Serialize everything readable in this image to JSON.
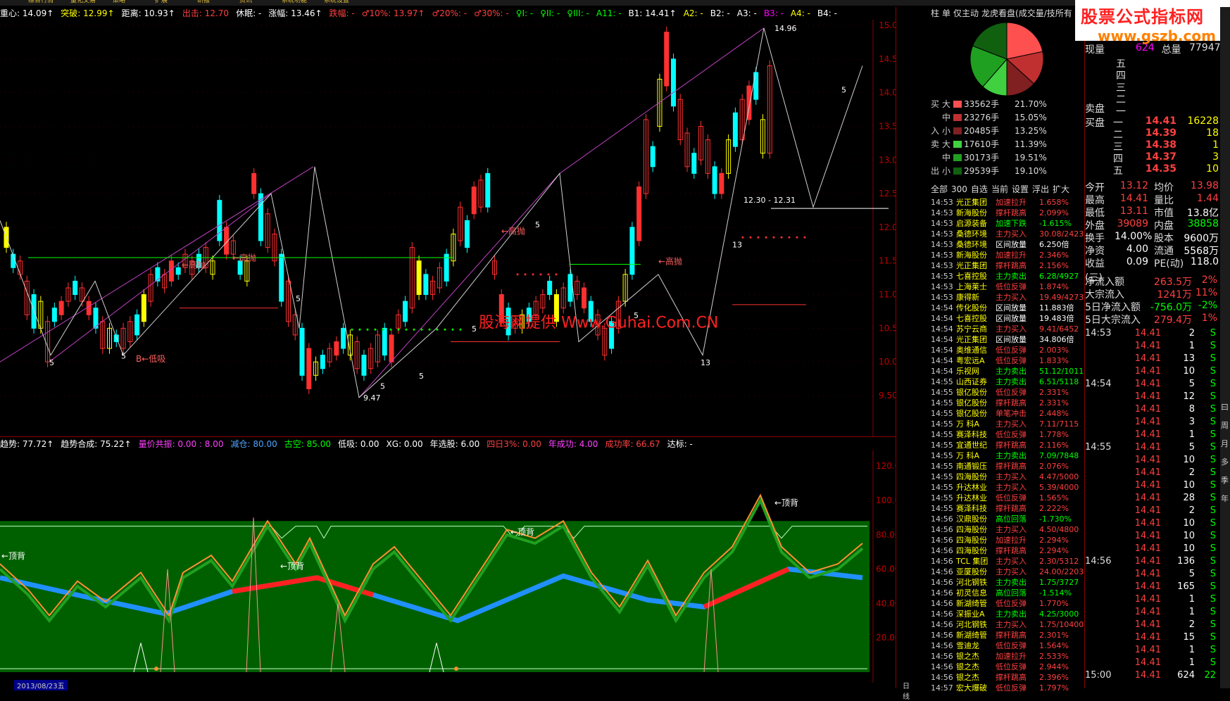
{
  "menubar": [
    "综合行情",
    "量化交易",
    "策略",
    "扩展",
    "研报",
    "资讯",
    "系统功能",
    "系统设置"
  ],
  "indicator_bar": [
    {
      "text": "重心: 14.09↑",
      "color": "#ffffff"
    },
    {
      "text": "突破: 12.99↑",
      "color": "#ffff00"
    },
    {
      "text": "距离: 10.93↑",
      "color": "#ffffff"
    },
    {
      "text": "出击: 12.70",
      "color": "#ff4040"
    },
    {
      "text": "休眠: -",
      "color": "#ffffff"
    },
    {
      "text": "涨幅: 13.46↑",
      "color": "#ffffff"
    },
    {
      "text": "跌幅: -",
      "color": "#ff4040"
    },
    {
      "text": "♂10%: 13.97↑",
      "color": "#ff4040"
    },
    {
      "text": "♂20%: -",
      "color": "#ff4040"
    },
    {
      "text": "♂30%: -",
      "color": "#ff4040"
    },
    {
      "text": "♀I: -",
      "color": "#00ff00"
    },
    {
      "text": "♀II: -",
      "color": "#00ff00"
    },
    {
      "text": "♀III: -",
      "color": "#00ff00"
    },
    {
      "text": "A11: -",
      "color": "#00ff00"
    },
    {
      "text": "B1: 14.41↑",
      "color": "#ffffff"
    },
    {
      "text": "A2: -",
      "color": "#ffff00"
    },
    {
      "text": "B2: -",
      "color": "#ffffff"
    },
    {
      "text": "A3: -",
      "color": "#ffffff"
    },
    {
      "text": "B3: -",
      "color": "#ff00ff"
    },
    {
      "text": "A4: -",
      "color": "#ffff00"
    },
    {
      "text": "B4: -",
      "color": "#ffffff"
    }
  ],
  "osc_bar": [
    {
      "text": "趋势: 77.72↑",
      "color": "#ffffff"
    },
    {
      "text": "趋势合成: 75.22↑",
      "color": "#ffffff"
    },
    {
      "text": "量价共振: 0.00 : 8.00",
      "color": "#ff40ff"
    },
    {
      "text": "减仓: 80.00",
      "color": "#4da6ff"
    },
    {
      "text": "古空: 85.00",
      "color": "#00ff00"
    },
    {
      "text": "低吸: 0.00",
      "color": "#ffffff"
    },
    {
      "text": "XG: 0.00",
      "color": "#ffffff"
    },
    {
      "text": "年选股: 6.00",
      "color": "#ffffff"
    },
    {
      "text": "四日3%: 0.00",
      "color": "#ff4040"
    },
    {
      "text": "年成功: 4.00",
      "color": "#ff40ff"
    },
    {
      "text": "成功率: 66.67",
      "color": "#ff4040"
    },
    {
      "text": "达标: -",
      "color": "#ffffff"
    }
  ],
  "price_axis": [
    "15.00",
    "14.50",
    "14.00",
    "13.50",
    "13.00",
    "12.50",
    "12.00",
    "11.50",
    "11.00",
    "10.50",
    "10.00",
    "9.50"
  ],
  "osc_axis": [
    "120.00",
    "100.00",
    "80.00",
    "60.00",
    "40.00",
    "20.00"
  ],
  "chart_labels": {
    "high": "14.96",
    "low": "9.47",
    "range": "12.30 - 12.31",
    "watermark": "股海网提供 Www.Guhai.Com.CN",
    "sell_hint": "高抛",
    "buy_hint": "低吸",
    "top_div": "←顶背",
    "date": "2013/08/23五",
    "period": "日线"
  },
  "rp1": {
    "tabs_top": [
      "柱",
      "单",
      "仅主动",
      "龙虎看盘(成交量/技所有"
    ],
    "flow_in_label": "入",
    "flow_out_label": "出",
    "flow_buy_label": "买",
    "flow_sell_label": "卖",
    "flows": [
      {
        "side": "买",
        "size": "大",
        "hands": "33562手",
        "pct": "21.70%",
        "color": "#ff5050"
      },
      {
        "side": "",
        "size": "中",
        "hands": "23276手",
        "pct": "15.05%",
        "color": "#c03030"
      },
      {
        "side": "入",
        "size": "小",
        "hands": "20485手",
        "pct": "13.25%",
        "color": "#802020"
      },
      {
        "side": "卖",
        "size": "大",
        "hands": "17610手",
        "pct": "11.39%",
        "color": "#40d040"
      },
      {
        "side": "",
        "size": "中",
        "hands": "30173手",
        "pct": "19.51%",
        "color": "#20a020"
      },
      {
        "side": "出",
        "size": "小",
        "hands": "29539手",
        "pct": "19.10%",
        "color": "#106010"
      }
    ],
    "tabs_bottom": [
      "全部",
      "300",
      "自选",
      "当前",
      "设置",
      "浮出",
      "扩大"
    ],
    "news": [
      {
        "t": "14:53",
        "s": "光正集团",
        "a": "加速拉升",
        "v": "1.658%",
        "c": "#ff4040"
      },
      {
        "t": "14:53",
        "s": "新海股份",
        "a": "撑杆跳高",
        "v": "2.099%",
        "c": "#ff4040"
      },
      {
        "t": "14:53",
        "s": "启源装备",
        "a": "加速下跌",
        "v": "-1.615%",
        "c": "#00ff00"
      },
      {
        "t": "14:53",
        "s": "桑德环境",
        "a": "主力买入",
        "v": "30.08/2423",
        "c": "#ff4040"
      },
      {
        "t": "14:53",
        "s": "桑德环境",
        "a": "区间放量",
        "v": "6.250倍",
        "c": "#ffffff"
      },
      {
        "t": "14:53",
        "s": "新海股份",
        "a": "加速拉升",
        "v": "2.346%",
        "c": "#ff4040"
      },
      {
        "t": "14:53",
        "s": "光正集团",
        "a": "撑杆跳高",
        "v": "2.156%",
        "c": "#ff4040"
      },
      {
        "t": "14:53",
        "s": "七喜控股",
        "a": "主力卖出",
        "v": "6.28/4927",
        "c": "#00ff00"
      },
      {
        "t": "14:53",
        "s": "上海莱士",
        "a": "低位反弹",
        "v": "1.874%",
        "c": "#ff4040"
      },
      {
        "t": "14:53",
        "s": "康得新",
        "a": "主力买入",
        "v": "19.49/4273",
        "c": "#ff4040"
      },
      {
        "t": "14:54",
        "s": "传化股份",
        "a": "区间放量",
        "v": "11.883倍",
        "c": "#ffffff"
      },
      {
        "t": "14:54",
        "s": "七喜控股",
        "a": "区间放量",
        "v": "19.483倍",
        "c": "#ffffff"
      },
      {
        "t": "14:54",
        "s": "苏宁云商",
        "a": "主力买入",
        "v": "9.41/6452",
        "c": "#ff4040"
      },
      {
        "t": "14:54",
        "s": "光正集团",
        "a": "区间放量",
        "v": "34.806倍",
        "c": "#ffffff"
      },
      {
        "t": "14:54",
        "s": "奥维通信",
        "a": "低位反弹",
        "v": "2.003%",
        "c": "#ff4040"
      },
      {
        "t": "14:54",
        "s": "粤宏远A",
        "a": "低位反弹",
        "v": "1.833%",
        "c": "#ff4040"
      },
      {
        "t": "14:54",
        "s": "乐视网",
        "a": "主力卖出",
        "v": "51.12/1011",
        "c": "#00ff00"
      },
      {
        "t": "14:55",
        "s": "山西证券",
        "a": "主力卖出",
        "v": "6.51/5118",
        "c": "#00ff00"
      },
      {
        "t": "14:55",
        "s": "银亿股份",
        "a": "低位反弹",
        "v": "2.331%",
        "c": "#ff4040"
      },
      {
        "t": "14:55",
        "s": "银亿股份",
        "a": "撑杆跳高",
        "v": "2.331%",
        "c": "#ff4040"
      },
      {
        "t": "14:55",
        "s": "银亿股份",
        "a": "单笔冲击",
        "v": "2.448%",
        "c": "#ff4040"
      },
      {
        "t": "14:55",
        "s": "万 科A",
        "a": "主力买入",
        "v": "7.11/7115",
        "c": "#ff4040"
      },
      {
        "t": "14:55",
        "s": "赛泽科技",
        "a": "低位反弹",
        "v": "1.778%",
        "c": "#ff4040"
      },
      {
        "t": "14:55",
        "s": "宜通世纪",
        "a": "撑杆跳高",
        "v": "2.116%",
        "c": "#ff4040"
      },
      {
        "t": "14:55",
        "s": "万 科A",
        "a": "主力卖出",
        "v": "7.09/7848",
        "c": "#00ff00"
      },
      {
        "t": "14:55",
        "s": "南通锻压",
        "a": "撑杆跳高",
        "v": "2.076%",
        "c": "#ff4040"
      },
      {
        "t": "14:55",
        "s": "四海股份",
        "a": "主力买入",
        "v": "4.47/5000",
        "c": "#ff4040"
      },
      {
        "t": "14:55",
        "s": "升达林业",
        "a": "主力买入",
        "v": "5.39/4000",
        "c": "#ff4040"
      },
      {
        "t": "14:55",
        "s": "升达林业",
        "a": "低位反弹",
        "v": "1.565%",
        "c": "#ff4040"
      },
      {
        "t": "14:55",
        "s": "赛泽科技",
        "a": "撑杆跳高",
        "v": "2.222%",
        "c": "#ff4040"
      },
      {
        "t": "14:56",
        "s": "汉鼎股份",
        "a": "高位回落",
        "v": "-1.730%",
        "c": "#00ff00"
      },
      {
        "t": "14:56",
        "s": "四海股份",
        "a": "主力买入",
        "v": "4.50/4800",
        "c": "#ff4040"
      },
      {
        "t": "14:56",
        "s": "四海股份",
        "a": "加速拉升",
        "v": "2.294%",
        "c": "#ff4040"
      },
      {
        "t": "14:56",
        "s": "四海股份",
        "a": "撑杆跳高",
        "v": "2.294%",
        "c": "#ff4040"
      },
      {
        "t": "14:56",
        "s": "TCL 集团",
        "a": "主力买入",
        "v": "2.30/5312",
        "c": "#ff4040"
      },
      {
        "t": "14:56",
        "s": "亚厦股份",
        "a": "主力买入",
        "v": "24.00/2203",
        "c": "#ff4040"
      },
      {
        "t": "14:56",
        "s": "河北钢铁",
        "a": "主力卖出",
        "v": "1.75/3727",
        "c": "#00ff00"
      },
      {
        "t": "14:56",
        "s": "初灵信息",
        "a": "高位回落",
        "v": "-1.514%",
        "c": "#00ff00"
      },
      {
        "t": "14:56",
        "s": "新湖绮管",
        "a": "低位反弹",
        "v": "1.770%",
        "c": "#ff4040"
      },
      {
        "t": "14:56",
        "s": "深振业A",
        "a": "主力卖出",
        "v": "4.25/3000",
        "c": "#00ff00"
      },
      {
        "t": "14:56",
        "s": "河北钢铁",
        "a": "主力买入",
        "v": "1.75/10400",
        "c": "#ff4040"
      },
      {
        "t": "14:56",
        "s": "新湖绮管",
        "a": "撑杆跳高",
        "v": "2.301%",
        "c": "#ff4040"
      },
      {
        "t": "14:56",
        "s": "雪迪龙",
        "a": "低位反弹",
        "v": "1.564%",
        "c": "#ff4040"
      },
      {
        "t": "14:56",
        "s": "银之杰",
        "a": "加速拉升",
        "v": "2.533%",
        "c": "#ff4040"
      },
      {
        "t": "14:56",
        "s": "银之杰",
        "a": "低位反弹",
        "v": "2.944%",
        "c": "#ff4040"
      },
      {
        "t": "14:56",
        "s": "银之杰",
        "a": "撑杆跳高",
        "v": "2.396%",
        "c": "#ff4040"
      },
      {
        "t": "14:57",
        "s": "宏大爆破",
        "a": "低位反弹",
        "v": "1.797%",
        "c": "#ff4040"
      }
    ]
  },
  "logo": {
    "line1": "股票公式指标网",
    "line2": "www.gszb.com"
  },
  "rp2": {
    "now_label": "现量",
    "now_val": "624",
    "total_label": "总量",
    "total_val": "77947",
    "sell_levels": [
      "五",
      "四",
      "三",
      "二",
      "一"
    ],
    "sell_label": "卖盘",
    "buy_label": "买盘",
    "buys": [
      {
        "lvl": "一",
        "price": "14.41",
        "vol": "16228"
      },
      {
        "lvl": "二",
        "price": "14.39",
        "vol": "18"
      },
      {
        "lvl": "三",
        "price": "14.38",
        "vol": "1"
      },
      {
        "lvl": "四",
        "price": "14.37",
        "vol": "3"
      },
      {
        "lvl": "五",
        "price": "14.35",
        "vol": "10"
      }
    ],
    "stats": [
      {
        "k1": "今开",
        "v1": "13.12",
        "k2": "均价",
        "v2": "13.98",
        "c1": "#ff4040",
        "c2": "#ff4040"
      },
      {
        "k1": "最高",
        "v1": "14.41",
        "k2": "量比",
        "v2": "1.44",
        "c1": "#ff4040",
        "c2": "#ff4040"
      },
      {
        "k1": "最低",
        "v1": "13.11",
        "k2": "市值",
        "v2": "13.8亿",
        "c1": "#ff4040",
        "c2": "#ffffff"
      },
      {
        "k1": "外盘",
        "v1": "39089",
        "k2": "内盘",
        "v2": "38858",
        "c1": "#ff4040",
        "c2": "#00ff00"
      },
      {
        "k1": "换手",
        "v1": "14.00%",
        "k2": "股本",
        "v2": "9600万",
        "c1": "#ffffff",
        "c2": "#ffffff"
      },
      {
        "k1": "净资",
        "v1": "4.00",
        "k2": "流通",
        "v2": "5568万",
        "c1": "#ffffff",
        "c2": "#ffffff"
      },
      {
        "k1": "收益(三)",
        "v1": "0.09",
        "k2": "PE(动)",
        "v2": "118.0",
        "c1": "#ffffff",
        "c2": "#ffffff"
      }
    ],
    "flows": [
      {
        "k": "净流入额",
        "v": "263.5万",
        "p": "2%",
        "c": "#ff4040"
      },
      {
        "k": "大宗流入",
        "v": "1241万",
        "p": "11%",
        "c": "#ff4040"
      },
      {
        "k": "5日净流入额",
        "v": "-756.0万",
        "p": "-2%",
        "c": "#00ff00"
      },
      {
        "k": "5日大宗流入",
        "v": "279.4万",
        "p": "1%",
        "c": "#ff4040"
      }
    ],
    "trades": [
      {
        "t": "14:53",
        "p": "14.41",
        "v": "2",
        "s": "S"
      },
      {
        "t": "",
        "p": "14.41",
        "v": "1",
        "s": "S"
      },
      {
        "t": "",
        "p": "14.41",
        "v": "13",
        "s": "S"
      },
      {
        "t": "",
        "p": "14.41",
        "v": "10",
        "s": "S"
      },
      {
        "t": "14:54",
        "p": "14.41",
        "v": "5",
        "s": "S"
      },
      {
        "t": "",
        "p": "14.41",
        "v": "12",
        "s": "S"
      },
      {
        "t": "",
        "p": "14.41",
        "v": "8",
        "s": "S"
      },
      {
        "t": "",
        "p": "14.41",
        "v": "3",
        "s": "S"
      },
      {
        "t": "",
        "p": "14.41",
        "v": "1",
        "s": "S"
      },
      {
        "t": "14:55",
        "p": "14.41",
        "v": "5",
        "s": "S"
      },
      {
        "t": "",
        "p": "14.41",
        "v": "10",
        "s": "S"
      },
      {
        "t": "",
        "p": "14.41",
        "v": "2",
        "s": "S"
      },
      {
        "t": "",
        "p": "14.41",
        "v": "10",
        "s": "S"
      },
      {
        "t": "",
        "p": "14.41",
        "v": "28",
        "s": "S"
      },
      {
        "t": "",
        "p": "14.41",
        "v": "2",
        "s": "S"
      },
      {
        "t": "",
        "p": "14.41",
        "v": "10",
        "s": "S"
      },
      {
        "t": "",
        "p": "14.41",
        "v": "10",
        "s": "S"
      },
      {
        "t": "",
        "p": "14.41",
        "v": "10",
        "s": "S"
      },
      {
        "t": "14:56",
        "p": "14.41",
        "v": "136",
        "s": "S"
      },
      {
        "t": "",
        "p": "14.41",
        "v": "5",
        "s": "S"
      },
      {
        "t": "",
        "p": "14.41",
        "v": "165",
        "s": "S"
      },
      {
        "t": "",
        "p": "14.41",
        "v": "1",
        "s": "S"
      },
      {
        "t": "",
        "p": "14.41",
        "v": "1",
        "s": "S"
      },
      {
        "t": "",
        "p": "14.41",
        "v": "2",
        "s": "S"
      },
      {
        "t": "",
        "p": "14.41",
        "v": "15",
        "s": "S"
      },
      {
        "t": "",
        "p": "14.41",
        "v": "1",
        "s": "S"
      },
      {
        "t": "",
        "p": "14.41",
        "v": "1",
        "s": "S"
      },
      {
        "t": "15:00",
        "p": "14.41",
        "v": "624",
        "s": "22"
      }
    ]
  },
  "side_toolbar": [
    "曰",
    "周",
    "月",
    "多",
    "季",
    "年"
  ]
}
